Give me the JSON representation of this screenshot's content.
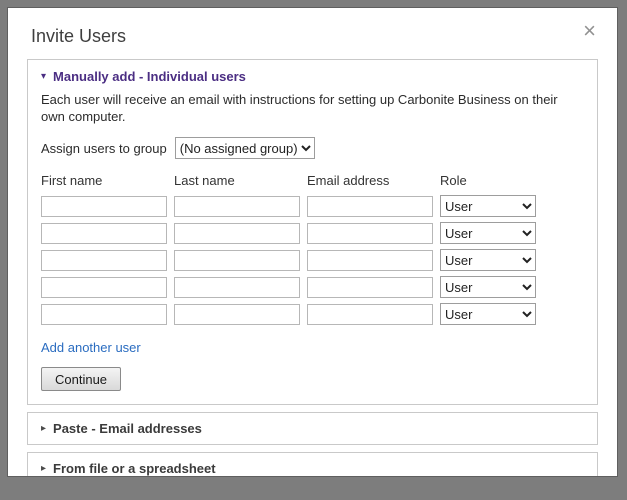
{
  "dialog": {
    "title": "Invite Users",
    "close_glyph": "×"
  },
  "accordion": {
    "manual": {
      "marker": "▾",
      "label": "Manually add - Individual users",
      "description": "Each user will receive an email with instructions for setting up Carbonite Business on their own computer.",
      "assign_label": "Assign users to group",
      "group_selected": "(No assigned group)",
      "columns": [
        "First name",
        "Last name",
        "Email address",
        "Role"
      ],
      "role_selected": "User",
      "add_user_link": "Add another user",
      "continue_label": "Continue"
    },
    "paste": {
      "marker": "▸",
      "label": "Paste - Email addresses"
    },
    "file": {
      "marker": "▸",
      "label": "From file or a spreadsheet"
    }
  },
  "colors": {
    "accent_purple": "#4b2e83",
    "link_blue": "#2a6cc0",
    "frame_gray": "#7d7d7d"
  }
}
